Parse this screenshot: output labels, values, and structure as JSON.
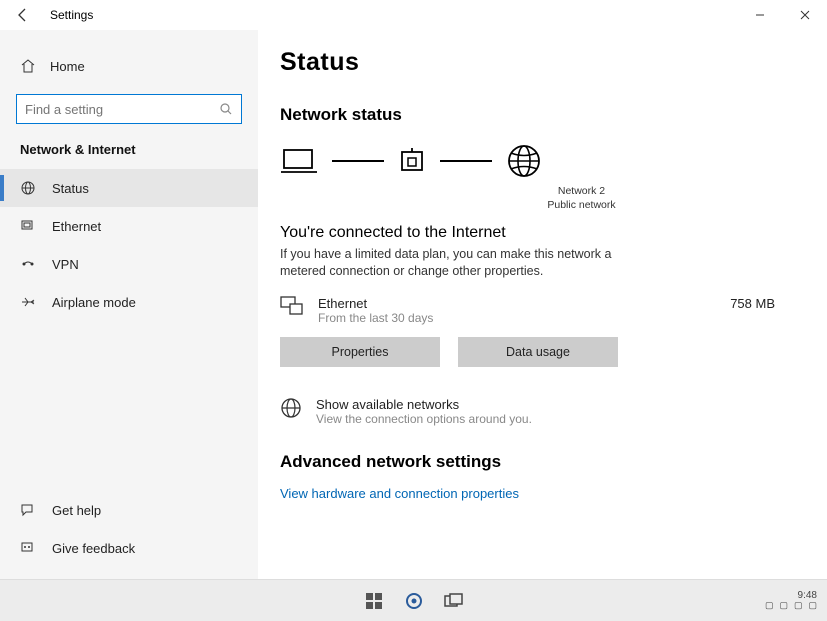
{
  "titlebar": {
    "title": "Settings"
  },
  "sidebar": {
    "home_label": "Home",
    "search_placeholder": "Find a setting",
    "section_label": "Network & Internet",
    "items": [
      {
        "label": "Status"
      },
      {
        "label": "Ethernet"
      },
      {
        "label": "VPN"
      },
      {
        "label": "Airplane mode"
      }
    ],
    "footer": [
      {
        "label": "Get help"
      },
      {
        "label": "Give feedback"
      }
    ]
  },
  "main": {
    "page_title": "Status",
    "network_status_header": "Network status",
    "diagram": {
      "network_name": "Network 2",
      "network_type": "Public network"
    },
    "connected_title": "You're connected to the Internet",
    "connected_desc": "If you have a limited data plan, you can make this network a metered connection or change other properties.",
    "usage": {
      "adapter": "Ethernet",
      "period": "From the last 30 days",
      "amount": "758 MB"
    },
    "buttons": {
      "properties": "Properties",
      "data_usage": "Data usage"
    },
    "available": {
      "title": "Show available networks",
      "sub": "View the connection options around you."
    },
    "advanced_header": "Advanced network settings",
    "hardware_link": "View hardware and connection properties"
  },
  "taskbar": {
    "clock": "9:48"
  }
}
